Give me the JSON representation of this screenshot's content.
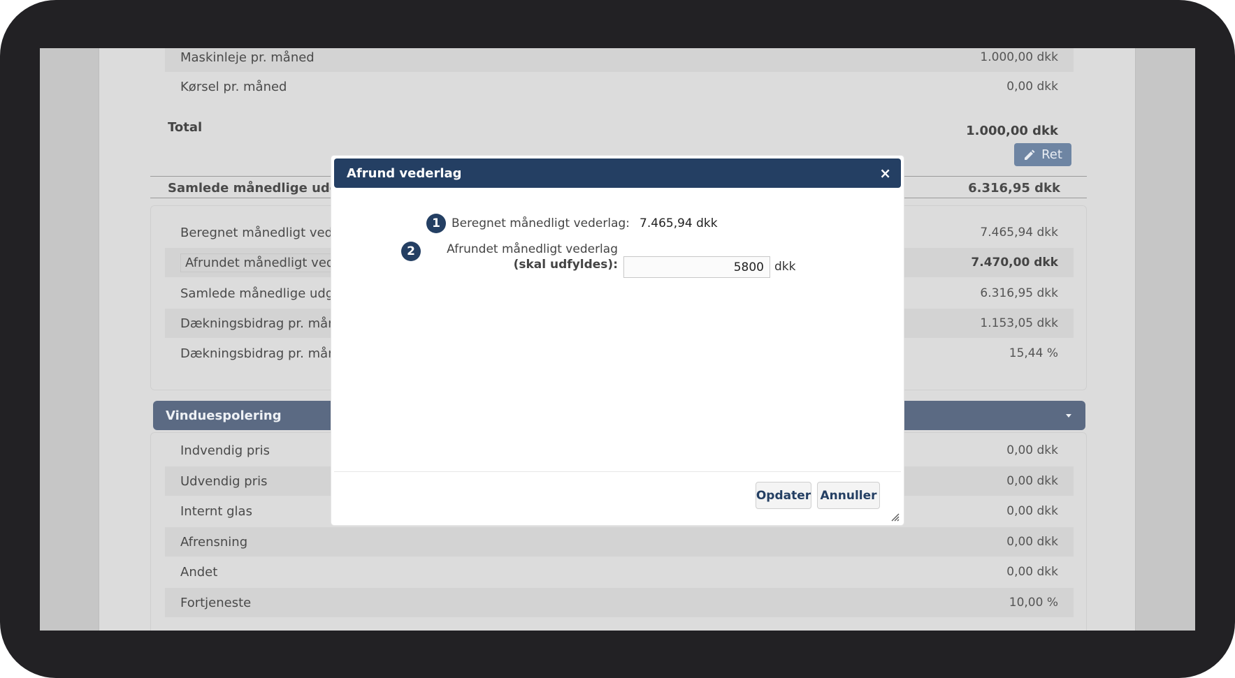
{
  "top_rows": [
    {
      "label": "Maskinleje pr. måned",
      "value": "1.000,00 dkk"
    },
    {
      "label": "Kørsel pr. måned",
      "value": "0,00 dkk"
    }
  ],
  "total": {
    "label": "Total",
    "value": "1.000,00 dkk",
    "edit_label": "Ret"
  },
  "summary": {
    "label": "Samlede månedlige udgifter",
    "value": "6.316,95 dkk"
  },
  "mid_rows": [
    {
      "label": "Beregnet månedligt vederlag",
      "value": "7.465,94 dkk"
    },
    {
      "label": "Afrundet månedligt vederlag",
      "value": "7.470,00 dkk"
    },
    {
      "label": "Samlede månedlige udgifter",
      "value": "6.316,95 dkk"
    },
    {
      "label": "Dækningsbidrag pr. måned",
      "value": "1.153,05 dkk"
    },
    {
      "label": "Dækningsbidrag pr. måned",
      "value": "15,44 %"
    }
  ],
  "section": {
    "title": "Vinduespolering"
  },
  "bottom_rows": [
    {
      "label": "Indvendig pris",
      "value": "0,00 dkk"
    },
    {
      "label": "Udvendig pris",
      "value": "0,00 dkk"
    },
    {
      "label": "Internt glas",
      "value": "0,00 dkk"
    },
    {
      "label": "Afrensning",
      "value": "0,00 dkk"
    },
    {
      "label": "Andet",
      "value": "0,00 dkk"
    },
    {
      "label": "Fortjeneste",
      "value": "10,00 %"
    }
  ],
  "modal": {
    "title": "Afrund vederlag",
    "close": "×",
    "field1": {
      "badge": "1",
      "label": "Beregnet månedligt vederlag:",
      "value": "7.465,94 dkk"
    },
    "field2": {
      "badge": "2",
      "label": "Afrundet månedligt vederlag",
      "label_bold": "(skal udfyldes)",
      "label_colon": ":",
      "value": "5800",
      "unit": "dkk"
    },
    "update_label": "Opdater",
    "cancel_label": "Annuller"
  }
}
